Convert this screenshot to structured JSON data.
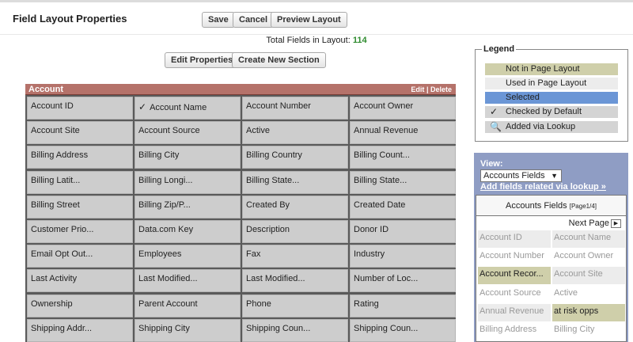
{
  "header": {
    "title": "Field Layout Properties",
    "buttons": {
      "save": "Save",
      "cancel": "Cancel",
      "preview": "Preview Layout"
    }
  },
  "summary": {
    "label": "Total Fields in Layout:",
    "count": "114"
  },
  "actions": {
    "edit_properties": "Edit Properties",
    "create_section": "Create New Section"
  },
  "section": {
    "title": "Account",
    "edit": "Edit",
    "separator": "|",
    "delete": "Delete",
    "fields": [
      [
        "Account ID",
        "Account Name",
        "Account Number",
        "Account Owner"
      ],
      [
        "Account Site",
        "Account Source",
        "Active",
        "Annual Revenue"
      ],
      [
        "Billing Address",
        "Billing City",
        "Billing Country",
        "Billing Count..."
      ],
      [
        "Billing Latit...",
        "Billing Longi...",
        "Billing State...",
        "Billing State..."
      ],
      [
        "Billing Street",
        "Billing Zip/P...",
        "Created By",
        "Created Date"
      ],
      [
        "Customer Prio...",
        "Data.com Key",
        "Description",
        "Donor ID"
      ],
      [
        "Email Opt Out...",
        "Employees",
        "Fax",
        "Industry"
      ],
      [
        "Last Activity",
        "Last Modified...",
        "Last Modified...",
        "Number of Loc..."
      ],
      [
        "Ownership",
        "Parent Account",
        "Phone",
        "Rating"
      ],
      [
        "Shipping Addr...",
        "Shipping City",
        "Shipping Coun...",
        "Shipping Coun..."
      ]
    ],
    "checked_field": "Account Name"
  },
  "legend": {
    "title": "Legend",
    "items": [
      {
        "label": "Not in Page Layout",
        "color": "#cfcfaa"
      },
      {
        "label": "Used in Page Layout",
        "color": "#ececec"
      },
      {
        "label": "Selected",
        "color": "#6b96d6"
      },
      {
        "label": "Checked by Default",
        "color": "#d4d4d4",
        "icon": "checkmark-icon"
      },
      {
        "label": "Added via Lookup",
        "color": "#d4d4d4",
        "icon": "magnifier-icon"
      }
    ]
  },
  "palette": {
    "view_label": "View:",
    "view_selected": "Accounts Fields",
    "lookup_link": "Add fields related via lookup »",
    "heading": "Accounts Fields",
    "page_indicator": "[Page1/4]",
    "next_page": "Next Page",
    "fields": [
      {
        "label": "Account ID",
        "state": "used"
      },
      {
        "label": "Account Name",
        "state": "used"
      },
      {
        "label": "Account Number",
        "state": "used"
      },
      {
        "label": "Account Owner",
        "state": "used"
      },
      {
        "label": "Account Recor...",
        "state": "notin"
      },
      {
        "label": "Account Site",
        "state": "used"
      },
      {
        "label": "Account Source",
        "state": "used"
      },
      {
        "label": "Active",
        "state": "used"
      },
      {
        "label": "Annual Revenue",
        "state": "used"
      },
      {
        "label": "at risk opps",
        "state": "notin"
      },
      {
        "label": "Billing Address",
        "state": "used"
      },
      {
        "label": "Billing City",
        "state": "used"
      }
    ]
  },
  "colors": {
    "section_header": "#b5726a",
    "palette_bg": "#8f9dc4",
    "count_color": "#2e8b2e"
  }
}
